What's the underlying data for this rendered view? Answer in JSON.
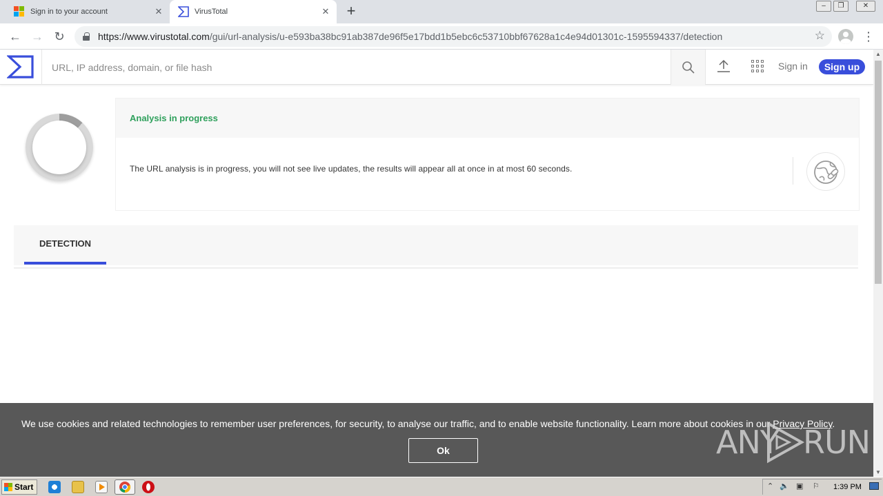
{
  "browser": {
    "tabs": [
      {
        "title": "Sign in to your account",
        "active": false
      },
      {
        "title": "VirusTotal",
        "active": true
      }
    ],
    "url_host": "https://www.virustotal.com",
    "url_path": "/gui/url-analysis/u-e593ba38bc91ab387de96f5e17bdd1b5ebc6c53710bbf67628a1c4e94d01301c-1595594337/detection"
  },
  "header": {
    "search_placeholder": "URL, IP address, domain, or file hash",
    "signin_label": "Sign in",
    "signup_label": "Sign up",
    "brand_color": "#394edb"
  },
  "analysis": {
    "status": "Analysis in progress",
    "status_color": "#2fa05c",
    "message": "The URL analysis is in progress, you will not see live updates, the results will appear all at once in at most 60 seconds.",
    "progress_fraction": 0.12
  },
  "tabs": [
    {
      "label": "DETECTION",
      "active": true
    }
  ],
  "cookie_banner": {
    "text": "We use cookies and related technologies to remember user preferences, for security, to analyse our traffic, and to enable website functionality. Learn more about cookies in our ",
    "link_label": "Privacy Policy",
    "text_end": ".",
    "button_label": "Ok"
  },
  "watermark": "ANY RUN",
  "taskbar": {
    "start_label": "Start",
    "clock": "1:39 PM"
  }
}
